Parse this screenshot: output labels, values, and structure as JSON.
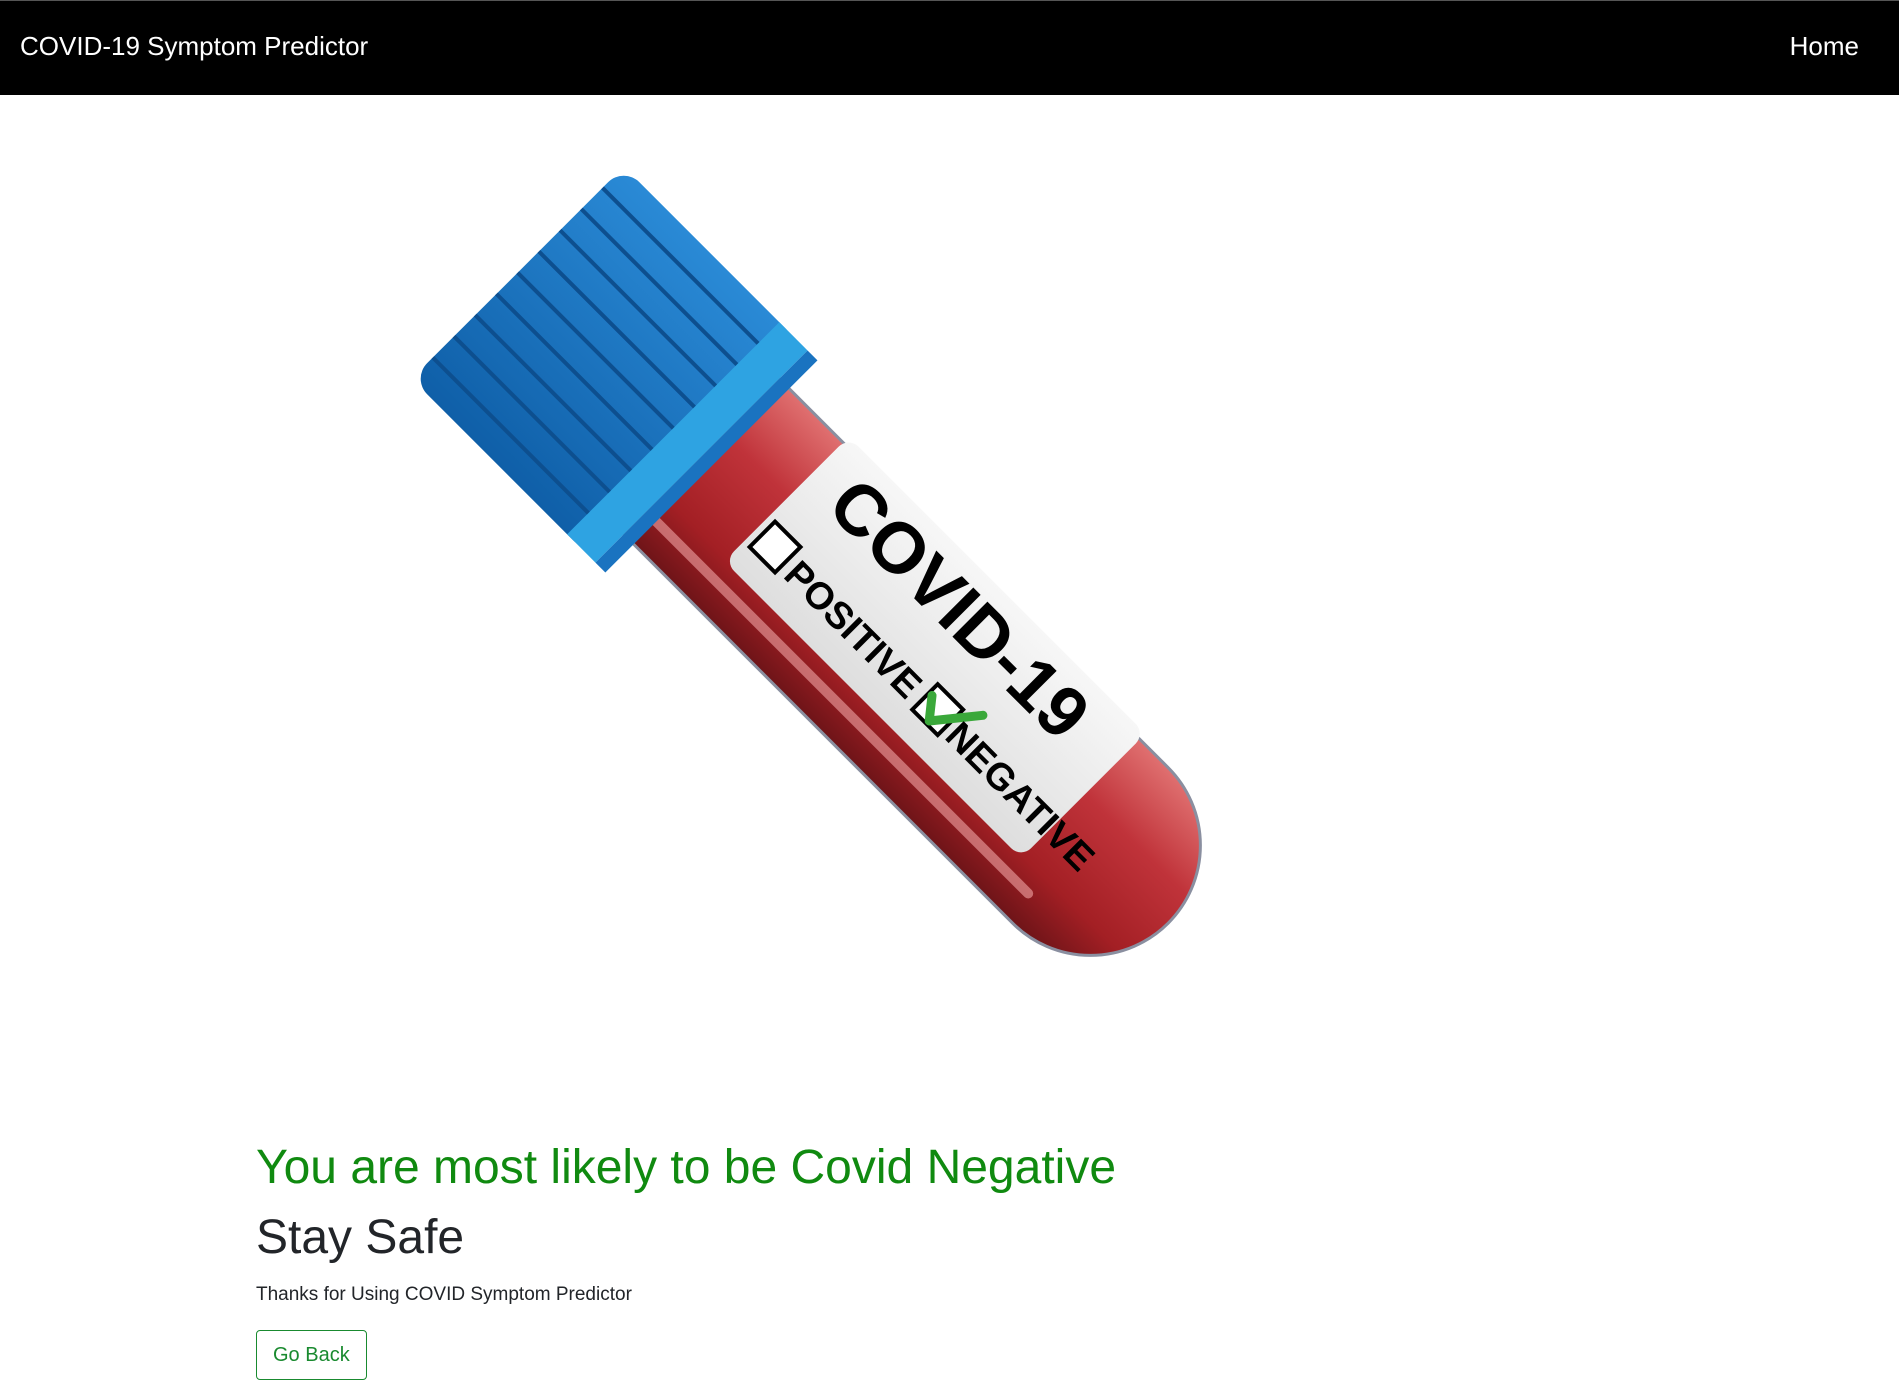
{
  "navbar": {
    "brand": "COVID-19 Symptom Predictor",
    "home_label": "Home"
  },
  "hero_image": {
    "tube_label_title": "COVID-19",
    "option_positive": "POSITIVE",
    "option_negative": "NEGATIVE",
    "checked_option": "NEGATIVE",
    "colors": {
      "cap": "#1a73c0",
      "cap_band": "#2ea3e2",
      "blood": "#a31f24",
      "check": "#3aa83a"
    }
  },
  "main": {
    "result_text": "You are most likely to be Covid Negative",
    "stay_safe": "Stay Safe",
    "thanks_text": "Thanks for Using COVID Symptom Predictor",
    "go_back_label": "Go Back"
  },
  "colors": {
    "navbar_bg": "#000000",
    "result_green": "#108a10",
    "button_green": "#198a2f"
  }
}
